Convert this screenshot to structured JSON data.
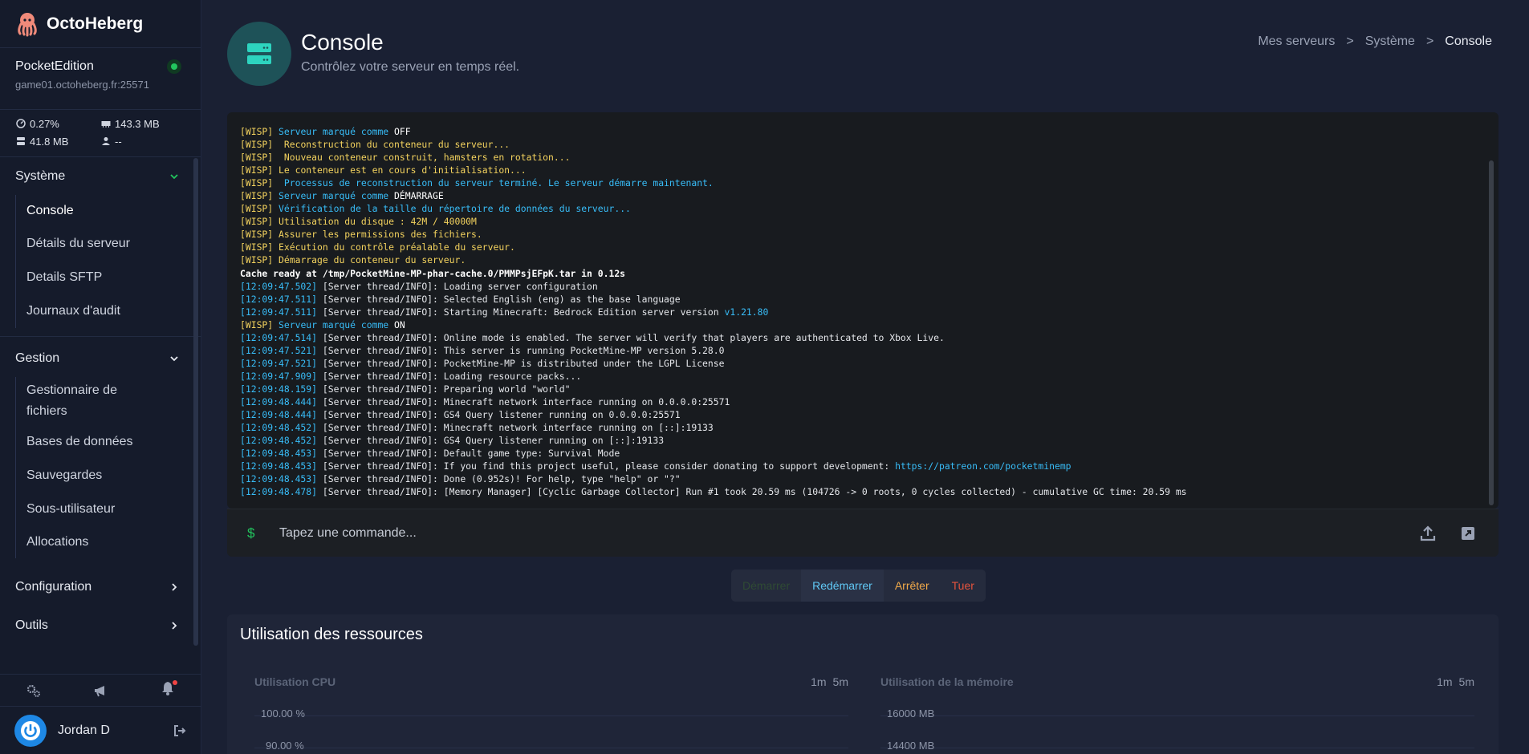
{
  "brand": {
    "name": "OctoHeberg"
  },
  "server": {
    "name": "PocketEdition",
    "host": "game01.octoheberg.fr:25571",
    "status_color": "#22c55e",
    "stats": {
      "cpu": "0.27%",
      "memory": "143.3 MB",
      "disk": "41.8 MB",
      "players": "--"
    }
  },
  "nav": {
    "systeme": {
      "label": "Système",
      "items": [
        "Console",
        "Détails du serveur",
        "Details SFTP",
        "Journaux d'audit"
      ]
    },
    "gestion": {
      "label": "Gestion",
      "items": [
        "Gestionnaire de fichiers",
        "Bases de données",
        "Sauvegardes",
        "Sous-utilisateur",
        "Allocations"
      ]
    },
    "configuration": {
      "label": "Configuration"
    },
    "outils": {
      "label": "Outils"
    }
  },
  "user": {
    "name": "Jordan D"
  },
  "header": {
    "title": "Console",
    "subtitle": "Contrôlez votre serveur en temps réel.",
    "breadcrumb": [
      "Mes serveurs",
      "Système",
      "Console"
    ]
  },
  "console": {
    "lines": [
      {
        "tag": "[WISP]",
        "parts": [
          [
            "c",
            " Serveur marqué comme "
          ],
          [
            "hi",
            "OFF"
          ]
        ]
      },
      {
        "tag": "[WISP]",
        "parts": [
          [
            "y",
            "  Reconstruction du conteneur du serveur..."
          ]
        ]
      },
      {
        "tag": "[WISP]",
        "parts": [
          [
            "y",
            "  Nouveau conteneur construit, hamsters en rotation..."
          ]
        ]
      },
      {
        "tag": "[WISP]",
        "parts": [
          [
            "y",
            " Le conteneur est en cours d'initialisation..."
          ]
        ]
      },
      {
        "tag": "[WISP]",
        "parts": [
          [
            "c",
            "  Processus de reconstruction du serveur terminé. Le serveur démarre maintenant."
          ]
        ]
      },
      {
        "tag": "[WISP]",
        "parts": [
          [
            "c",
            " Serveur marqué comme "
          ],
          [
            "hi",
            "DÉMARRAGE"
          ]
        ]
      },
      {
        "tag": "[WISP]",
        "parts": [
          [
            "c",
            " Vérification de la taille du répertoire de données du serveur..."
          ]
        ]
      },
      {
        "tag": "[WISP]",
        "parts": [
          [
            "y",
            " Utilisation du disque : 42M / 40000M"
          ]
        ]
      },
      {
        "tag": "[WISP]",
        "parts": [
          [
            "y",
            " Assurer les permissions des fichiers."
          ]
        ]
      },
      {
        "tag": "[WISP]",
        "parts": [
          [
            "y",
            " Exécution du contrôle préalable du serveur."
          ]
        ]
      },
      {
        "tag": "[WISP]",
        "parts": [
          [
            "y",
            " Démarrage du conteneur du serveur."
          ]
        ]
      },
      {
        "tag": "",
        "parts": [
          [
            "b",
            "Cache ready at /tmp/PocketMine-MP-phar-cache.0/PMMPsjEFpK.tar in 0.12s"
          ]
        ]
      },
      {
        "tag": "[12:09:47.502]",
        "parts": [
          [
            "g",
            " [Server thread/INFO]: Loading server configuration"
          ]
        ]
      },
      {
        "tag": "[12:09:47.511]",
        "parts": [
          [
            "g",
            " [Server thread/INFO]: Selected English (eng) as the base language"
          ]
        ]
      },
      {
        "tag": "[12:09:47.511]",
        "parts": [
          [
            "g",
            " [Server thread/INFO]: Starting Minecraft: Bedrock Edition server version "
          ],
          [
            "lk",
            "v1.21.80"
          ]
        ]
      },
      {
        "tag": "[WISP]",
        "parts": [
          [
            "c",
            " Serveur marqué comme "
          ],
          [
            "hi",
            "ON"
          ]
        ]
      },
      {
        "tag": "[12:09:47.514]",
        "parts": [
          [
            "g",
            " [Server thread/INFO]: Online mode is enabled. The server will verify that players are authenticated to Xbox Live."
          ]
        ]
      },
      {
        "tag": "[12:09:47.521]",
        "parts": [
          [
            "g",
            " [Server thread/INFO]: This server is running PocketMine-MP version 5.28.0"
          ]
        ]
      },
      {
        "tag": "[12:09:47.521]",
        "parts": [
          [
            "g",
            " [Server thread/INFO]: PocketMine-MP is distributed under the LGPL License"
          ]
        ]
      },
      {
        "tag": "[12:09:47.909]",
        "parts": [
          [
            "g",
            " [Server thread/INFO]: Loading resource packs..."
          ]
        ]
      },
      {
        "tag": "[12:09:48.159]",
        "parts": [
          [
            "g",
            " [Server thread/INFO]: Preparing world \"world\""
          ]
        ]
      },
      {
        "tag": "[12:09:48.444]",
        "parts": [
          [
            "g",
            " [Server thread/INFO]: Minecraft network interface running on 0.0.0.0:25571"
          ]
        ]
      },
      {
        "tag": "[12:09:48.444]",
        "parts": [
          [
            "g",
            " [Server thread/INFO]: GS4 Query listener running on 0.0.0.0:25571"
          ]
        ]
      },
      {
        "tag": "[12:09:48.452]",
        "parts": [
          [
            "g",
            " [Server thread/INFO]: Minecraft network interface running on [::]:19133"
          ]
        ]
      },
      {
        "tag": "[12:09:48.452]",
        "parts": [
          [
            "g",
            " [Server thread/INFO]: GS4 Query listener running on [::]:19133"
          ]
        ]
      },
      {
        "tag": "[12:09:48.453]",
        "parts": [
          [
            "g",
            " [Server thread/INFO]: Default game type: Survival Mode"
          ]
        ]
      },
      {
        "tag": "[12:09:48.453]",
        "parts": [
          [
            "g",
            " [Server thread/INFO]: If you find this project useful, please consider donating to support development: "
          ],
          [
            "lk",
            "https://patreon.com/pocketminemp"
          ]
        ]
      },
      {
        "tag": "[12:09:48.453]",
        "parts": [
          [
            "g",
            " [Server thread/INFO]: Done (0.952s)! For help, type \"help\" or \"?\""
          ]
        ]
      },
      {
        "tag": "[12:09:48.478]",
        "parts": [
          [
            "g",
            " [Server thread/INFO]: [Memory Manager] [Cyclic Garbage Collector] Run #1 took 20.59 ms (104726 -> 0 roots, 0 cycles collected) - cumulative GC time: 20.59 ms"
          ]
        ]
      }
    ],
    "prompt": "$",
    "placeholder": "Tapez une commande..."
  },
  "power": {
    "start": "Démarrer",
    "restart": "Redémarrer",
    "stop": "Arrêter",
    "kill": "Tuer"
  },
  "resources": {
    "title": "Utilisation des ressources",
    "cpu": {
      "title": "Utilisation CPU",
      "ranges": [
        "1m",
        "5m"
      ],
      "ticks": [
        "100.00 %",
        "90.00 %"
      ]
    },
    "memory": {
      "title": "Utilisation de la mémoire",
      "ranges": [
        "1m",
        "5m"
      ],
      "ticks": [
        "16000 MB",
        "14400 MB"
      ]
    }
  }
}
